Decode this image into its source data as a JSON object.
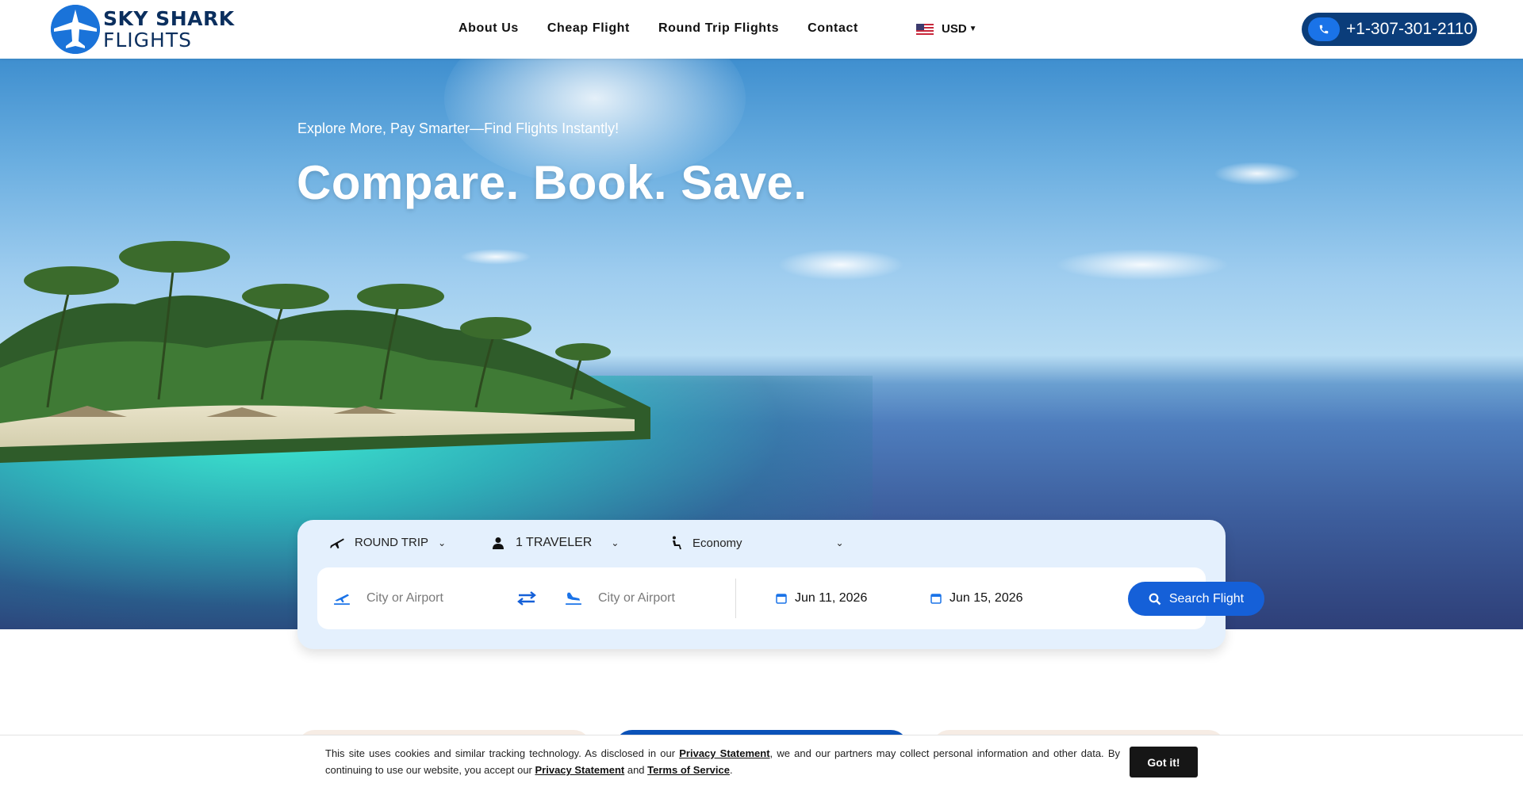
{
  "brand": {
    "line1": "SKY SHARK",
    "line2": "FLIGHTS",
    "color": "#0b2f5e"
  },
  "nav": [
    {
      "label": "About Us"
    },
    {
      "label": "Cheap Flight"
    },
    {
      "label": "Round Trip Flights"
    },
    {
      "label": "Contact"
    }
  ],
  "currency": {
    "label": "USD",
    "flag": "us-flag-icon"
  },
  "phone": {
    "number": "+1-307-301-2110",
    "icon": "phone-icon"
  },
  "hero": {
    "subtitle": "Explore More, Pay Smarter—Find Flights Instantly!",
    "title": "Compare. Book. Save."
  },
  "search": {
    "trip_type": "ROUND TRIP",
    "travelers": "1 TRAVELER",
    "cabin": "Economy",
    "from_placeholder": "City or Airport",
    "to_placeholder": "City or Airport",
    "depart_date": "Jun 11, 2026",
    "return_date": "Jun 15, 2026",
    "button_label": "Search Flight"
  },
  "cookie": {
    "text1": "This site uses cookies and similar tracking technology. As disclosed in our ",
    "link1": "Privacy Statement",
    "text2": ", we and our partners may collect personal information and other data. By continuing to use our website, you accept our ",
    "link2": "Privacy Statement",
    "text3": " and ",
    "link3": "Terms of Service",
    "text4": ".",
    "button": "Got it!"
  },
  "colors": {
    "accent": "#1560d8",
    "navy": "#0b3d7a",
    "panel": "#e4f0fd"
  }
}
